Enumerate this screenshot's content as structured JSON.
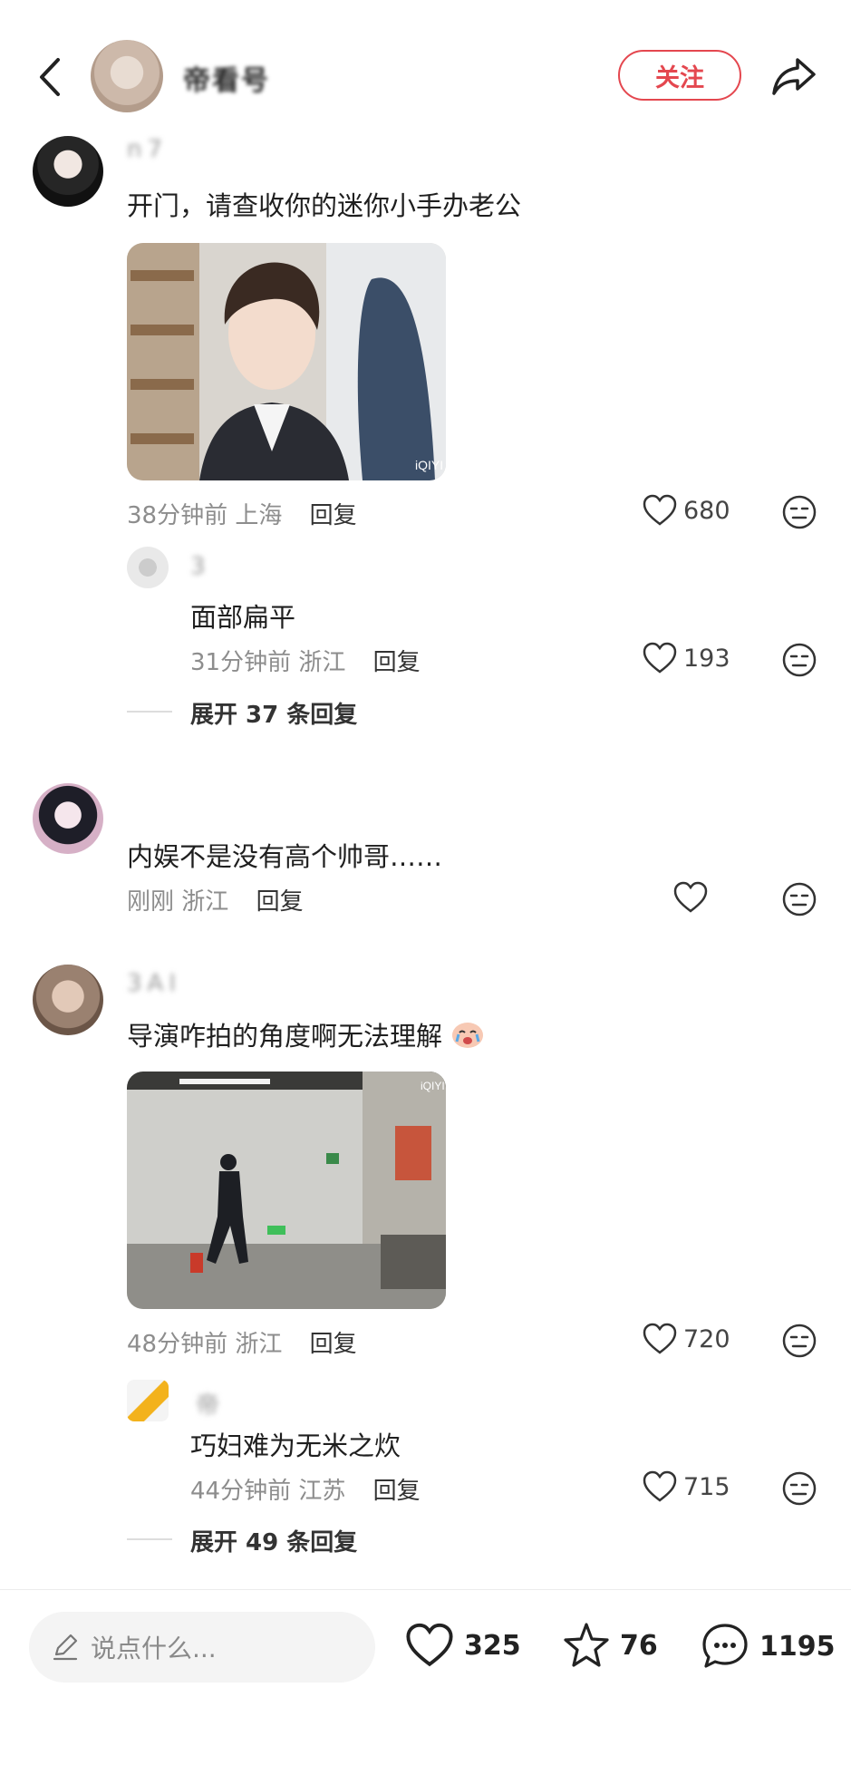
{
  "header": {
    "account_name": "帝看号",
    "follow_label": "关注"
  },
  "comments": [
    {
      "username": "n7",
      "text": "开门，请查收你的迷你小手办老公",
      "time": "38分钟前",
      "location": "上海",
      "reply_label": "回复",
      "likes": "680",
      "replies": [
        {
          "username": "3",
          "text": "面部扁平",
          "time": "31分钟前",
          "location": "浙江",
          "reply_label": "回复",
          "likes": "193"
        }
      ],
      "expand_label": "展开 37 条回复"
    },
    {
      "username": "",
      "text": "内娱不是没有高个帅哥……",
      "time": "刚刚",
      "location": "浙江",
      "reply_label": "回复",
      "likes": ""
    },
    {
      "username": "3AI",
      "text": "导演咋拍的角度啊无法理解",
      "time": "48分钟前",
      "location": "浙江",
      "reply_label": "回复",
      "likes": "720",
      "replies": [
        {
          "username": "帝",
          "text": "巧妇难为无米之炊",
          "time": "44分钟前",
          "location": "江苏",
          "reply_label": "回复",
          "likes": "715"
        }
      ],
      "expand_label": "展开 49 条回复"
    }
  ],
  "image_watermark": "iQIYI",
  "bottom_bar": {
    "input_placeholder": "说点什么...",
    "likes": "325",
    "stars": "76",
    "comments": "1195"
  },
  "colors": {
    "accent": "#e4474f",
    "meta_text": "#8d8d8d"
  }
}
